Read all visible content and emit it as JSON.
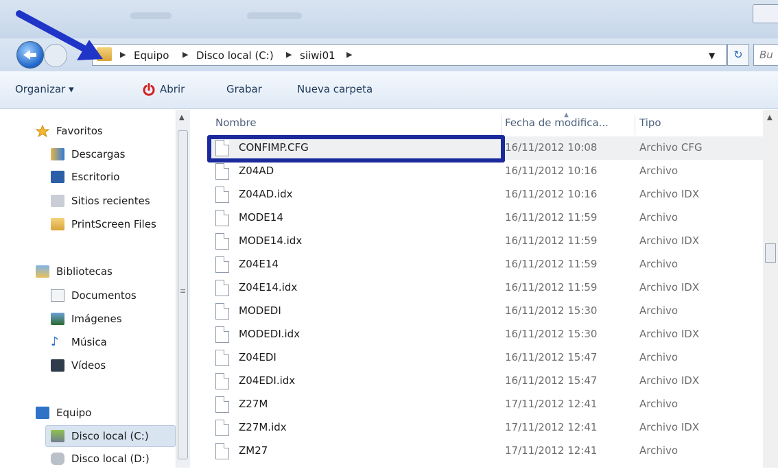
{
  "window": {
    "title": ""
  },
  "address": {
    "crumbs": [
      "Equipo",
      "Disco local (C:)",
      "siiwi01"
    ],
    "search_placeholder": "Bu"
  },
  "toolbar": {
    "organize": "Organizar ▾",
    "open": "Abrir",
    "burn": "Grabar",
    "new_folder": "Nueva carpeta"
  },
  "nav": {
    "favorites": "Favoritos",
    "downloads": "Descargas",
    "desktop": "Escritorio",
    "recent": "Sitios recientes",
    "printscreen": "PrintScreen Files",
    "libraries": "Bibliotecas",
    "documents": "Documentos",
    "images": "Imágenes",
    "music": "Música",
    "videos": "Vídeos",
    "computer": "Equipo",
    "disk_c": "Disco local (C:)",
    "disk_d": "Disco local (D:)"
  },
  "columns": {
    "name": "Nombre",
    "date": "Fecha de modifica...",
    "type": "Tipo"
  },
  "files": [
    {
      "name": "CONFIMP.CFG",
      "date": "16/11/2012 10:08",
      "type": "Archivo CFG"
    },
    {
      "name": "Z04AD",
      "date": "16/11/2012 10:16",
      "type": "Archivo"
    },
    {
      "name": "Z04AD.idx",
      "date": "16/11/2012 10:16",
      "type": "Archivo IDX"
    },
    {
      "name": "MODE14",
      "date": "16/11/2012 11:59",
      "type": "Archivo"
    },
    {
      "name": "MODE14.idx",
      "date": "16/11/2012 11:59",
      "type": "Archivo IDX"
    },
    {
      "name": "Z04E14",
      "date": "16/11/2012 11:59",
      "type": "Archivo"
    },
    {
      "name": "Z04E14.idx",
      "date": "16/11/2012 11:59",
      "type": "Archivo IDX"
    },
    {
      "name": "MODEDI",
      "date": "16/11/2012 15:30",
      "type": "Archivo"
    },
    {
      "name": "MODEDI.idx",
      "date": "16/11/2012 15:30",
      "type": "Archivo IDX"
    },
    {
      "name": "Z04EDI",
      "date": "16/11/2012 15:47",
      "type": "Archivo"
    },
    {
      "name": "Z04EDI.idx",
      "date": "16/11/2012 15:47",
      "type": "Archivo IDX"
    },
    {
      "name": "Z27M",
      "date": "17/11/2012 12:41",
      "type": "Archivo"
    },
    {
      "name": "Z27M.idx",
      "date": "17/11/2012 12:41",
      "type": "Archivo IDX"
    },
    {
      "name": "ZM27",
      "date": "17/11/2012 12:41",
      "type": "Archivo"
    }
  ],
  "colors": {
    "highlight": "#1a2a9c",
    "arrow": "#1f35c8"
  }
}
